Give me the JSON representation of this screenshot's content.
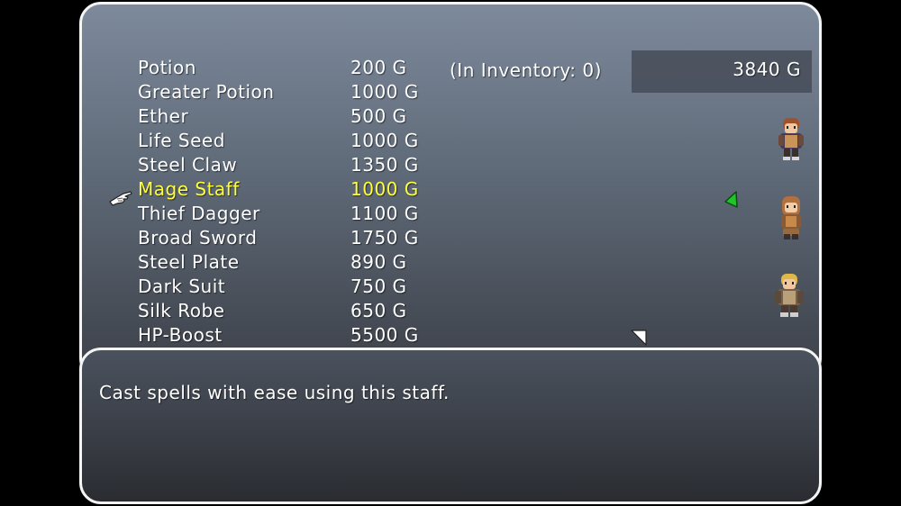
{
  "shop": {
    "items": [
      {
        "name": "Potion",
        "price": "200 G"
      },
      {
        "name": "Greater Potion",
        "price": "1000 G"
      },
      {
        "name": "Ether",
        "price": "500 G"
      },
      {
        "name": "Life Seed",
        "price": "1000 G"
      },
      {
        "name": "Steel Claw",
        "price": "1350 G"
      },
      {
        "name": "Mage Staff",
        "price": "1000 G"
      },
      {
        "name": "Thief Dagger",
        "price": "1100 G"
      },
      {
        "name": "Broad Sword",
        "price": "1750 G"
      },
      {
        "name": "Steel Plate",
        "price": "890 G"
      },
      {
        "name": "Dark Suit",
        "price": "750 G"
      },
      {
        "name": "Silk Robe",
        "price": "650 G"
      },
      {
        "name": "HP-Boost",
        "price": "5500 G"
      }
    ],
    "selected_index": 5,
    "inventory_text": "(In Inventory: 0)",
    "gold": "3840 G"
  },
  "help": {
    "text": "Cast spells with ease using this staff."
  },
  "party": [
    {
      "icon": "party-member-1-sprite"
    },
    {
      "icon": "party-member-2-sprite"
    },
    {
      "icon": "party-member-3-sprite"
    }
  ],
  "colors": {
    "text": "#ffffff",
    "highlight": "#ffff3c",
    "equip_arrow": "#22c22a",
    "window_border": "#f4f4f4"
  }
}
